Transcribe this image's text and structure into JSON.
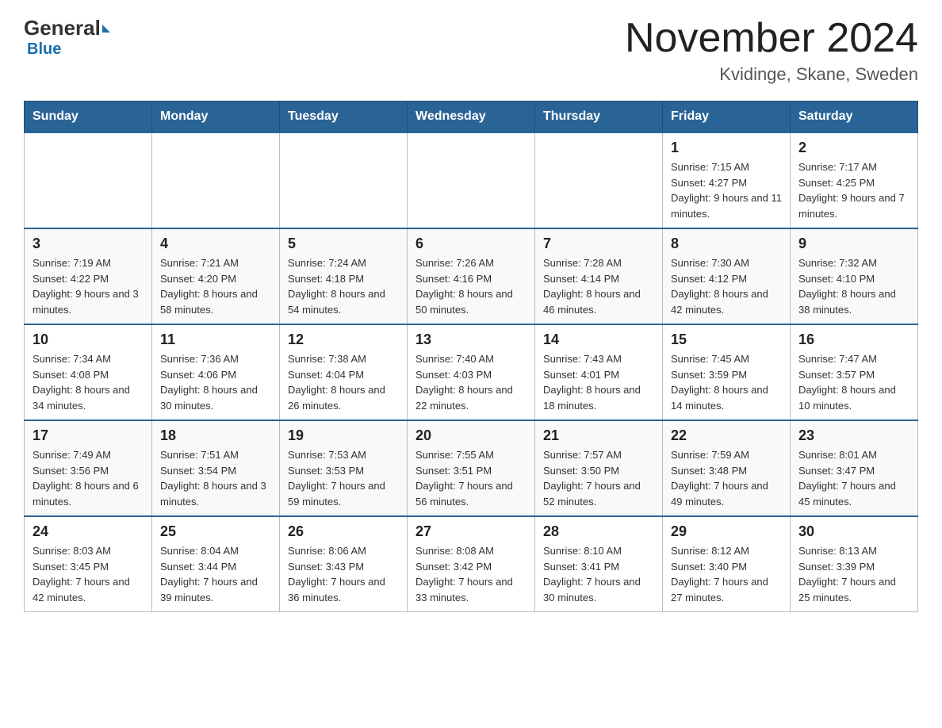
{
  "header": {
    "logo_text": "General",
    "logo_blue": "Blue",
    "month_title": "November 2024",
    "location": "Kvidinge, Skane, Sweden"
  },
  "days_of_week": [
    "Sunday",
    "Monday",
    "Tuesday",
    "Wednesday",
    "Thursday",
    "Friday",
    "Saturday"
  ],
  "weeks": [
    [
      {
        "day": "",
        "info": ""
      },
      {
        "day": "",
        "info": ""
      },
      {
        "day": "",
        "info": ""
      },
      {
        "day": "",
        "info": ""
      },
      {
        "day": "",
        "info": ""
      },
      {
        "day": "1",
        "info": "Sunrise: 7:15 AM\nSunset: 4:27 PM\nDaylight: 9 hours and 11 minutes."
      },
      {
        "day": "2",
        "info": "Sunrise: 7:17 AM\nSunset: 4:25 PM\nDaylight: 9 hours and 7 minutes."
      }
    ],
    [
      {
        "day": "3",
        "info": "Sunrise: 7:19 AM\nSunset: 4:22 PM\nDaylight: 9 hours and 3 minutes."
      },
      {
        "day": "4",
        "info": "Sunrise: 7:21 AM\nSunset: 4:20 PM\nDaylight: 8 hours and 58 minutes."
      },
      {
        "day": "5",
        "info": "Sunrise: 7:24 AM\nSunset: 4:18 PM\nDaylight: 8 hours and 54 minutes."
      },
      {
        "day": "6",
        "info": "Sunrise: 7:26 AM\nSunset: 4:16 PM\nDaylight: 8 hours and 50 minutes."
      },
      {
        "day": "7",
        "info": "Sunrise: 7:28 AM\nSunset: 4:14 PM\nDaylight: 8 hours and 46 minutes."
      },
      {
        "day": "8",
        "info": "Sunrise: 7:30 AM\nSunset: 4:12 PM\nDaylight: 8 hours and 42 minutes."
      },
      {
        "day": "9",
        "info": "Sunrise: 7:32 AM\nSunset: 4:10 PM\nDaylight: 8 hours and 38 minutes."
      }
    ],
    [
      {
        "day": "10",
        "info": "Sunrise: 7:34 AM\nSunset: 4:08 PM\nDaylight: 8 hours and 34 minutes."
      },
      {
        "day": "11",
        "info": "Sunrise: 7:36 AM\nSunset: 4:06 PM\nDaylight: 8 hours and 30 minutes."
      },
      {
        "day": "12",
        "info": "Sunrise: 7:38 AM\nSunset: 4:04 PM\nDaylight: 8 hours and 26 minutes."
      },
      {
        "day": "13",
        "info": "Sunrise: 7:40 AM\nSunset: 4:03 PM\nDaylight: 8 hours and 22 minutes."
      },
      {
        "day": "14",
        "info": "Sunrise: 7:43 AM\nSunset: 4:01 PM\nDaylight: 8 hours and 18 minutes."
      },
      {
        "day": "15",
        "info": "Sunrise: 7:45 AM\nSunset: 3:59 PM\nDaylight: 8 hours and 14 minutes."
      },
      {
        "day": "16",
        "info": "Sunrise: 7:47 AM\nSunset: 3:57 PM\nDaylight: 8 hours and 10 minutes."
      }
    ],
    [
      {
        "day": "17",
        "info": "Sunrise: 7:49 AM\nSunset: 3:56 PM\nDaylight: 8 hours and 6 minutes."
      },
      {
        "day": "18",
        "info": "Sunrise: 7:51 AM\nSunset: 3:54 PM\nDaylight: 8 hours and 3 minutes."
      },
      {
        "day": "19",
        "info": "Sunrise: 7:53 AM\nSunset: 3:53 PM\nDaylight: 7 hours and 59 minutes."
      },
      {
        "day": "20",
        "info": "Sunrise: 7:55 AM\nSunset: 3:51 PM\nDaylight: 7 hours and 56 minutes."
      },
      {
        "day": "21",
        "info": "Sunrise: 7:57 AM\nSunset: 3:50 PM\nDaylight: 7 hours and 52 minutes."
      },
      {
        "day": "22",
        "info": "Sunrise: 7:59 AM\nSunset: 3:48 PM\nDaylight: 7 hours and 49 minutes."
      },
      {
        "day": "23",
        "info": "Sunrise: 8:01 AM\nSunset: 3:47 PM\nDaylight: 7 hours and 45 minutes."
      }
    ],
    [
      {
        "day": "24",
        "info": "Sunrise: 8:03 AM\nSunset: 3:45 PM\nDaylight: 7 hours and 42 minutes."
      },
      {
        "day": "25",
        "info": "Sunrise: 8:04 AM\nSunset: 3:44 PM\nDaylight: 7 hours and 39 minutes."
      },
      {
        "day": "26",
        "info": "Sunrise: 8:06 AM\nSunset: 3:43 PM\nDaylight: 7 hours and 36 minutes."
      },
      {
        "day": "27",
        "info": "Sunrise: 8:08 AM\nSunset: 3:42 PM\nDaylight: 7 hours and 33 minutes."
      },
      {
        "day": "28",
        "info": "Sunrise: 8:10 AM\nSunset: 3:41 PM\nDaylight: 7 hours and 30 minutes."
      },
      {
        "day": "29",
        "info": "Sunrise: 8:12 AM\nSunset: 3:40 PM\nDaylight: 7 hours and 27 minutes."
      },
      {
        "day": "30",
        "info": "Sunrise: 8:13 AM\nSunset: 3:39 PM\nDaylight: 7 hours and 25 minutes."
      }
    ]
  ]
}
